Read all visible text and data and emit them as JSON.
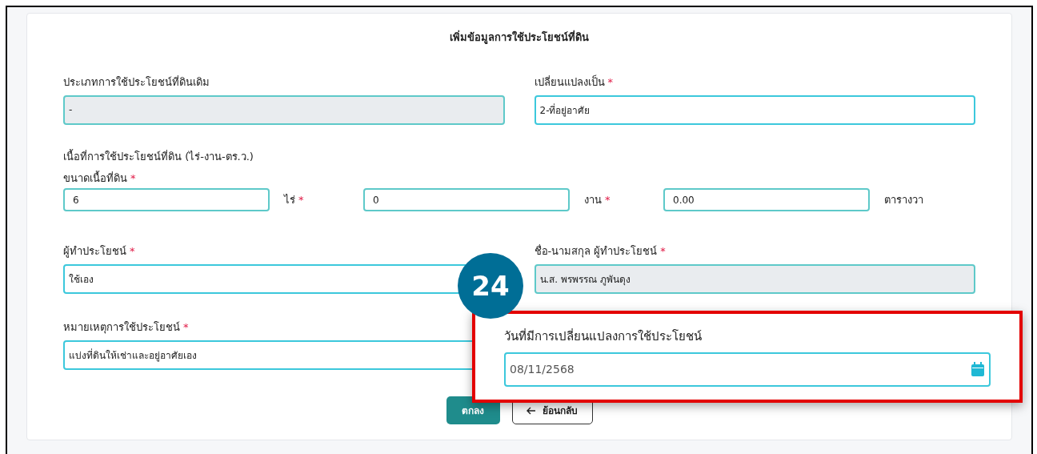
{
  "form": {
    "title": "เพิ่มข้อมูลการใช้ประโยชน์ที่ดิน",
    "top_fields": [
      {
        "label": "ประเภทการใช้ประโยชน์ที่ดินเดิม",
        "value": "-",
        "disabled": true
      },
      {
        "label": "เปลี่ยนแปลงเป็น",
        "mark": "*",
        "value": "2-ที่อยู่อาศัย",
        "disabled": false
      }
    ],
    "area": {
      "heading": "เนื้อที่การใช้ประโยชน์ที่ดิน (ไร่-งาน-ตร.ว.)",
      "label": "ขนาดเนื้อที่ดิน",
      "mark": "*",
      "parts": [
        {
          "value": "6",
          "unit": "ไร่",
          "mark": "*"
        },
        {
          "value": "0",
          "unit": "งาน",
          "mark": "*"
        },
        {
          "value": "0.00",
          "unit": "ตารางวา"
        }
      ]
    },
    "lower_fields": [
      {
        "label": "ผู้ทำประโยชน์",
        "mark": "*",
        "value": "ใช้เอง",
        "disabled": false
      },
      {
        "label": "ชื่อ-นามสกุล ผู้ทำประโยชน์",
        "mark": "*",
        "value": "น.ส. พรพรรณ ภูพันดุง",
        "disabled": true
      },
      {
        "label": "หมายเหตุการใช้ประโยชน์",
        "mark": "*",
        "value": "แบ่งที่ดินให้เช่าและอยู่อาศัยเอง",
        "disabled": false
      }
    ],
    "buttons": [
      {
        "kind": "primary",
        "label": "ตกลง"
      },
      {
        "kind": "back",
        "label": "ย้อนกลับ"
      }
    ]
  },
  "callout": {
    "badge": "24",
    "label": "วันที่มีการเปลี่ยนแปลงการใช้ประโยชน์",
    "value": "08/11/2568"
  }
}
